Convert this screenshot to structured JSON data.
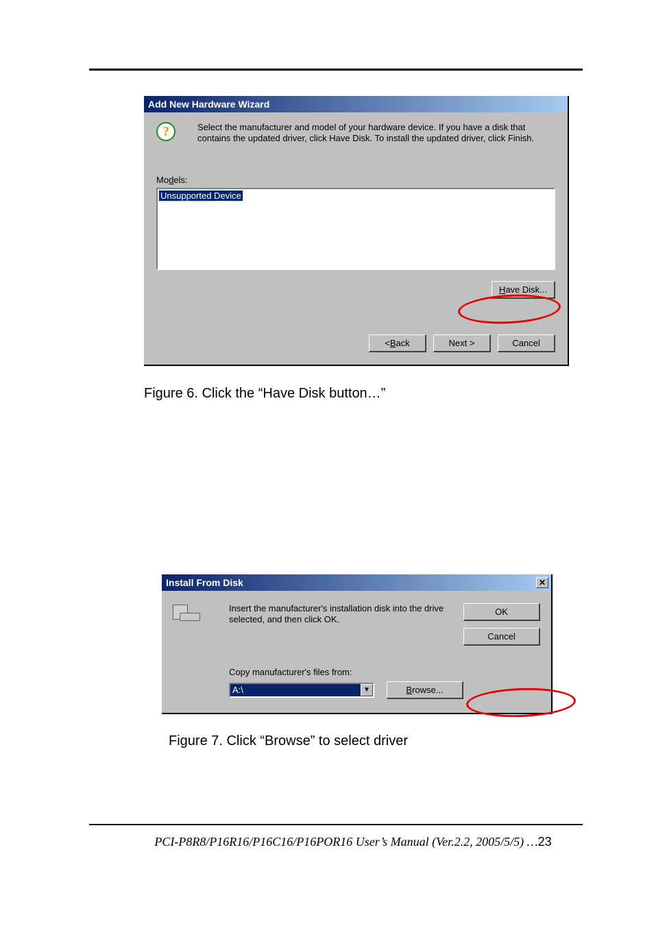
{
  "dialog1": {
    "title": "Add New Hardware Wizard",
    "intro": "Select the manufacturer and model of your hardware device. If you have a disk that contains the updated driver, click Have Disk. To install the updated driver, click Finish.",
    "models_label_pre": "Mo",
    "models_label_ul": "d",
    "models_label_post": "els:",
    "list_item": "Unsupported Device",
    "have_disk_ul": "H",
    "have_disk_rest": "ave Disk...",
    "back_lt": "< ",
    "back_ul": "B",
    "back_rest": "ack",
    "next": "Next >",
    "cancel": "Cancel"
  },
  "caption1": "Figure 6. Click the “Have Disk button…”",
  "dialog2": {
    "title": "Install From Disk",
    "intro": "Insert the manufacturer's installation disk into the drive selected, and then click OK.",
    "copy_label": "Copy manufacturer's files from:",
    "combo_value": "A:\\",
    "ok": "OK",
    "cancel": "Cancel",
    "browse_ul": "B",
    "browse_rest": "rowse..."
  },
  "caption2": "Figure 7. Click “Browse” to select driver",
  "footer": {
    "text": "PCI-P8R8/P16R16/P16C16/P16POR16 User’s Manual  (Ver.2.2, 2005/5/5) …",
    "page": "23"
  }
}
